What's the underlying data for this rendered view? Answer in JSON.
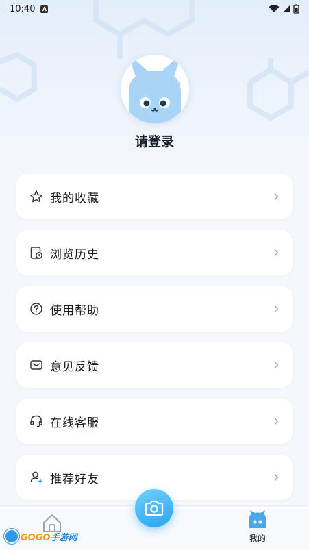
{
  "status_bar": {
    "time": "10:40",
    "sim_badge": "A"
  },
  "profile": {
    "login_text": "请登录"
  },
  "menu": [
    {
      "label": "我的收藏",
      "icon": "star-icon"
    },
    {
      "label": "浏览历史",
      "icon": "history-icon"
    },
    {
      "label": "使用帮助",
      "icon": "help-icon"
    },
    {
      "label": "意见反馈",
      "icon": "mail-icon"
    },
    {
      "label": "在线客服",
      "icon": "headset-icon"
    },
    {
      "label": "推荐好友",
      "icon": "user-share-icon"
    }
  ],
  "bottom_nav": {
    "home_icon": "home-icon",
    "camera_icon": "camera-icon",
    "mine_label": "我的",
    "mine_icon": "cat-icon"
  },
  "watermark": {
    "brand_a": "GOGO",
    "brand_b": "手游网"
  },
  "colors": {
    "accent": "#2aa4f0",
    "background": "#f4f7fb",
    "card": "#ffffff"
  }
}
